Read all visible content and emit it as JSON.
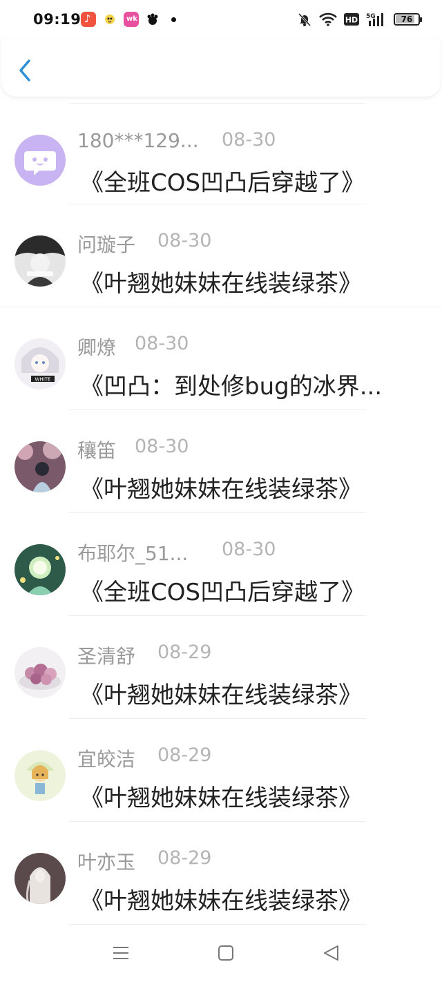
{
  "status_bar": {
    "time": "09:19",
    "battery": "76",
    "network": "5G",
    "hd": "HD"
  },
  "header": {
    "back_icon": "chevron-left-icon",
    "accent_color": "#2b8fd6"
  },
  "comments": [
    {
      "username": "180***129...",
      "date": "08-30",
      "title": "《全班COS凹凸后穿越了》",
      "avatar_color": "#c8b4f2"
    },
    {
      "username": "问璇子",
      "date": "08-30",
      "title": "《叶翘她妹妹在线装绿茶》",
      "avatar_color": "#3a3a3a"
    },
    {
      "username": "卿燎",
      "date": "08-30",
      "title": "《凹凸：到处修bug的冰界...",
      "avatar_color": "#e9e6ee"
    },
    {
      "username": "穰笛",
      "date": "08-30",
      "title": "《叶翘她妹妹在线装绿茶》",
      "avatar_color": "#8a6b78"
    },
    {
      "username": "布耶尔_51...",
      "date": "08-30",
      "title": "《全班COS凹凸后穿越了》",
      "avatar_color": "#4f8a6a"
    },
    {
      "username": "圣清舒",
      "date": "08-29",
      "title": "《叶翘她妹妹在线装绿茶》",
      "avatar_color": "#d7b8cf"
    },
    {
      "username": "宜皎洁",
      "date": "08-29",
      "title": "《叶翘她妹妹在线装绿茶》",
      "avatar_color": "#eef3d8"
    },
    {
      "username": "叶亦玉",
      "date": "08-29",
      "title": "《叶翘她妹妹在线装绿茶》",
      "avatar_color": "#6b5b5b"
    }
  ],
  "nav": {
    "menu_icon": "menu-icon",
    "home_icon": "home-square-icon",
    "back_icon": "back-triangle-icon"
  }
}
